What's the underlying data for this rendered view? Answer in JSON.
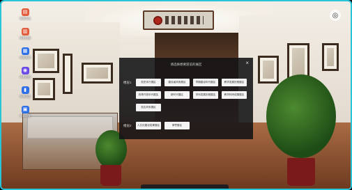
{
  "sidebar": {
    "items": [
      {
        "label": "场景导览",
        "icon": "tour-icon",
        "color": "#e25b3c",
        "glyph": "▤"
      },
      {
        "label": "场景切换",
        "icon": "switch-icon",
        "color": "#e25b3c",
        "glyph": "▥"
      },
      {
        "label": "场景说明",
        "icon": "info-icon",
        "color": "#2f6fe8",
        "glyph": "▦"
      },
      {
        "label": "场景地图",
        "icon": "map-pin-icon",
        "color": "#6a4be8",
        "glyph": "◉"
      },
      {
        "label": "场景语音",
        "icon": "audio-icon",
        "color": "#2f6fe8",
        "glyph": "▮"
      },
      {
        "label": "分享场景",
        "icon": "share-icon",
        "color": "#2f6fe8",
        "glyph": "▣"
      }
    ]
  },
  "modal": {
    "title": "请选择想要游览的展区",
    "close_glyph": "×",
    "floors": [
      {
        "label": "楼层1",
        "buttons": [
          "校史序厅展区",
          "建设者风采展区",
          "早期建设年代展区",
          "教学发展历程展区",
          "改革开放年代展区",
          "新时代展区",
          "学科发展历程展区",
          "教学科研成果展区",
          "校友风采展区"
        ]
      },
      {
        "label": "楼层2",
        "buttons": [
          "人文化建设成果展区",
          "荣誉展区"
        ]
      }
    ]
  },
  "colors": {
    "accent": "#28c4d8"
  }
}
